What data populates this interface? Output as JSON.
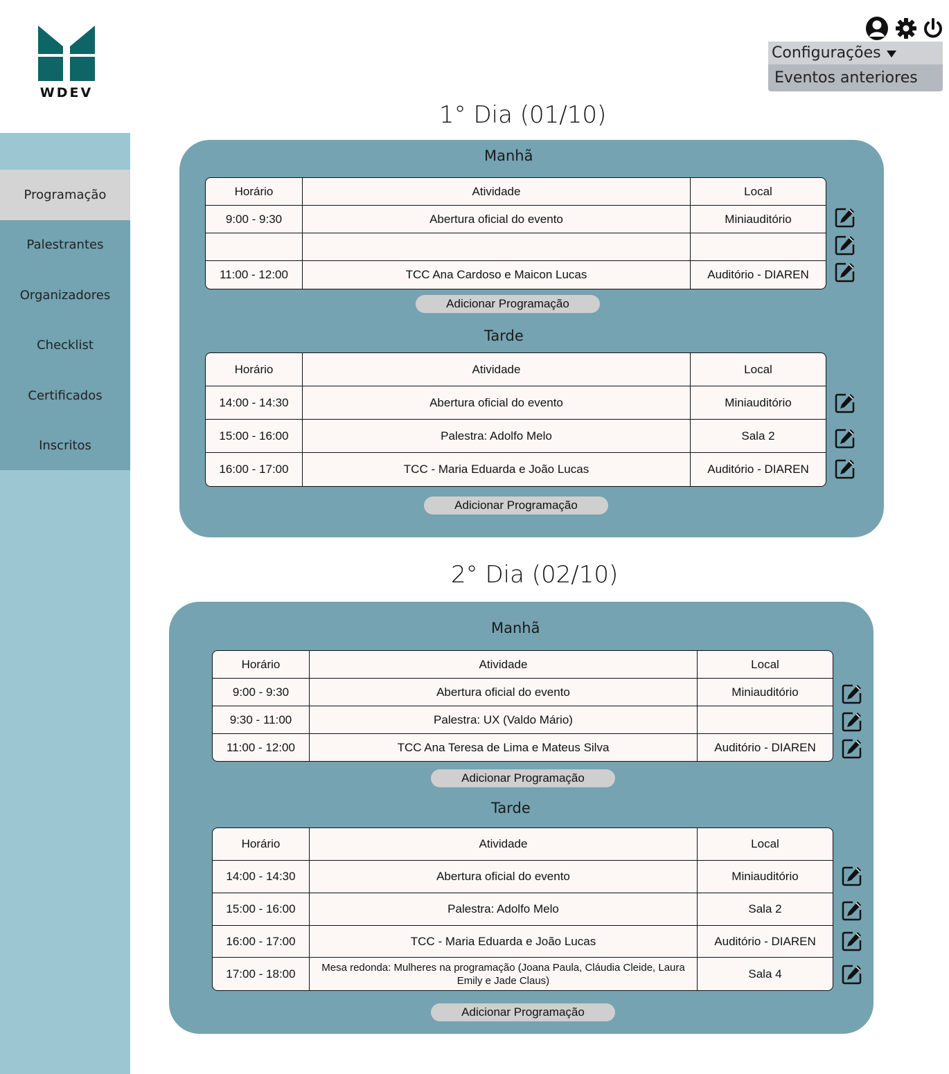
{
  "brand": {
    "logo_text": "WDEV",
    "color": "#0f6466"
  },
  "colors": {
    "sidebar": "#9dc6d3",
    "nav": "#74a3b1",
    "nav_active": "#d4d4d4",
    "panel": "#75a3b1",
    "button": "#cfcfcf"
  },
  "header": {
    "icons": [
      "user-icon",
      "gear-icon",
      "power-icon"
    ],
    "menu": {
      "config_label": "Configurações",
      "previous_label": "Eventos anteriores"
    }
  },
  "sidebar": {
    "items": [
      {
        "label": "Programação",
        "active": true
      },
      {
        "label": "Palestrantes"
      },
      {
        "label": "Organizadores"
      },
      {
        "label": "Checklist"
      },
      {
        "label": "Certificados"
      },
      {
        "label": "Inscritos"
      }
    ]
  },
  "days": [
    {
      "title": "1° Dia (01/10)",
      "morning": {
        "title": "Manhã",
        "headers": [
          "Horário",
          "Atividade",
          "Local"
        ],
        "rows": [
          [
            "9:00 - 9:30",
            "Abertura oficial do evento",
            "Miniauditório"
          ],
          [
            "",
            "",
            ""
          ],
          [
            "11:00 - 12:00",
            "TCC Ana Cardoso e Maicon Lucas",
            "Auditório - DIAREN"
          ]
        ],
        "add_label": "Adicionar Programação"
      },
      "afternoon": {
        "title": "Tarde",
        "headers": [
          "Horário",
          "Atividade",
          "Local"
        ],
        "rows": [
          [
            "14:00 - 14:30",
            "Abertura oficial do evento",
            "Miniauditório"
          ],
          [
            "15:00 - 16:00",
            "Palestra: Adolfo Melo",
            "Sala 2"
          ],
          [
            "16:00 - 17:00",
            "TCC - Maria Eduarda e João Lucas",
            "Auditório - DIAREN"
          ]
        ],
        "add_label": "Adicionar Programação"
      }
    },
    {
      "title": "2° Dia (02/10)",
      "morning": {
        "title": "Manhã",
        "headers": [
          "Horário",
          "Atividade",
          "Local"
        ],
        "rows": [
          [
            "9:00 - 9:30",
            "Abertura oficial do evento",
            "Miniauditório"
          ],
          [
            "9:30 - 11:00",
            "Palestra: UX (Valdo Mário)",
            ""
          ],
          [
            "11:00 - 12:00",
            "TCC Ana Teresa de Lima e Mateus Silva",
            "Auditório - DIAREN"
          ]
        ],
        "add_label": "Adicionar Programação"
      },
      "afternoon": {
        "title": "Tarde",
        "headers": [
          "Horário",
          "Atividade",
          "Local"
        ],
        "rows": [
          [
            "14:00 - 14:30",
            "Abertura oficial do evento",
            "Miniauditório"
          ],
          [
            "15:00 - 16:00",
            "Palestra: Adolfo Melo",
            "Sala 2"
          ],
          [
            "16:00 - 17:00",
            "TCC - Maria Eduarda e João Lucas",
            "Auditório - DIAREN"
          ],
          [
            "17:00 - 18:00",
            "Mesa redonda: Mulheres na programação (Joana Paula, Cláudia Cleide, Laura Emily e Jade Claus)",
            "Sala 4"
          ]
        ],
        "add_label": "Adicionar Programação"
      }
    }
  ]
}
